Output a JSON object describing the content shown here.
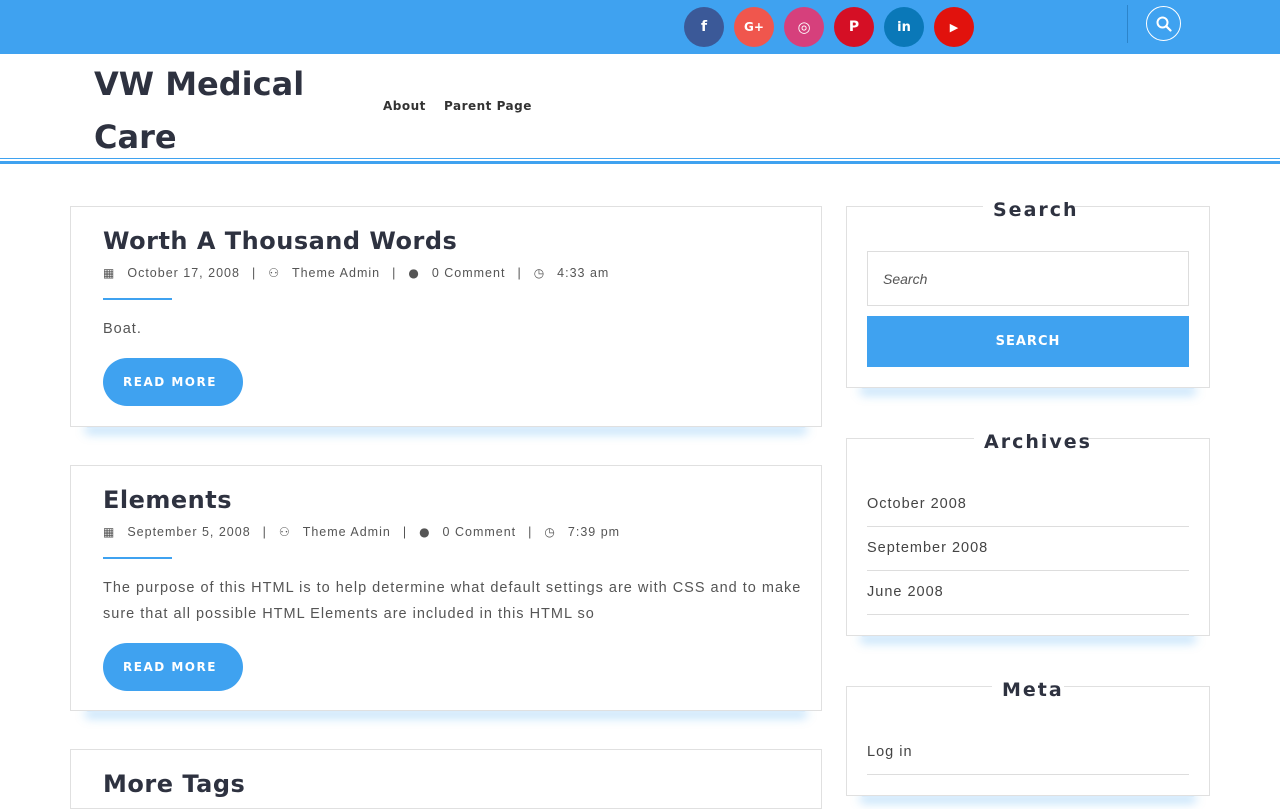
{
  "colors": {
    "accent": "#3fa2f0",
    "title_text": "#2e3240",
    "facebook": "#3b5998",
    "google_plus": "#f0564d",
    "instagram": "#d6407c",
    "pinterest": "#d50f25",
    "linkedin": "#0a78b8",
    "youtube": "#e1120d"
  },
  "topbar": {
    "social_icons": [
      "facebook-icon",
      "google-plus-icon",
      "instagram-icon",
      "pinterest-icon",
      "linkedin-icon",
      "youtube-icon"
    ],
    "social_glyphs": {
      "facebook": "f",
      "google_plus": "G+",
      "instagram": "◎",
      "pinterest": "P",
      "linkedin": "in",
      "youtube": "▶"
    },
    "search_icon": "search-icon"
  },
  "header": {
    "site_title": "VW Medical Care",
    "nav": [
      "About",
      "Parent Page"
    ]
  },
  "posts": [
    {
      "title": "Worth A Thousand Words",
      "date": "October 17, 2008",
      "author": "Theme Admin",
      "comments": "0 Comment",
      "time": "4:33 am",
      "excerpt": "Boat.",
      "read_more": "READ MORE"
    },
    {
      "title": "Elements",
      "date": "September 5, 2008",
      "author": "Theme Admin",
      "comments": "0 Comment",
      "time": "7:39 pm",
      "excerpt": "The purpose of this HTML is to help determine what default settings are with CSS and to make sure that all possible HTML Elements are included in this HTML so",
      "read_more": "READ MORE"
    },
    {
      "title": "More Tags"
    }
  ],
  "meta_separator": "|",
  "sidebar": {
    "search": {
      "title": "Search",
      "placeholder": "Search",
      "button": "SEARCH"
    },
    "archives": {
      "title": "Archives",
      "items": [
        "October 2008",
        "September 2008",
        "June 2008"
      ]
    },
    "meta": {
      "title": "Meta",
      "items": [
        "Log in"
      ]
    }
  }
}
